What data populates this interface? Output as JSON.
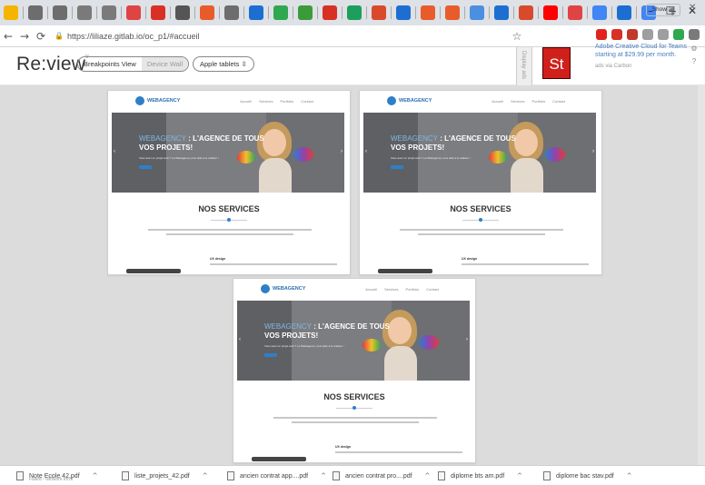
{
  "browser": {
    "url": "https://liliaze.gitlab.io/oc_p1/#accueil",
    "tabs": [
      {
        "icon": "bookmark-icon",
        "color": "#f5b400"
      },
      {
        "icon": "at-icon",
        "color": "#6d6d6d"
      },
      {
        "icon": "at-icon",
        "color": "#6d6d6d"
      },
      {
        "icon": "page-icon",
        "color": "#7a7a7a"
      },
      {
        "icon": "page-icon",
        "color": "#7a7a7a"
      },
      {
        "icon": "heart-icon",
        "color": "#e04343"
      },
      {
        "icon": "mail-icon",
        "color": "#d93025"
      },
      {
        "icon": "send-icon",
        "color": "#555555"
      },
      {
        "icon": "ring-icon",
        "color": "#e85c2c"
      },
      {
        "icon": "at-icon",
        "color": "#6d6d6d"
      },
      {
        "icon": "grid-icon",
        "color": "#1c6fd1"
      },
      {
        "icon": "drive-icon",
        "color": "#2fa84f"
      },
      {
        "icon": "hat-icon",
        "color": "#3b9b3b"
      },
      {
        "icon": "mail-icon",
        "color": "#d93025"
      },
      {
        "icon": "sheet-icon",
        "color": "#1e9e5c"
      },
      {
        "icon": "pen-icon",
        "color": "#d84a2b"
      },
      {
        "icon": "globe-icon",
        "color": "#1c6fd1"
      },
      {
        "icon": "ring-icon",
        "color": "#e85c2c"
      },
      {
        "icon": "ring-icon",
        "color": "#e85c2c"
      },
      {
        "icon": "new-icon",
        "color": "#4b8fe0"
      },
      {
        "icon": "screen-icon",
        "color": "#1c6fd1"
      },
      {
        "icon": "chip-icon",
        "color": "#d84a2b"
      },
      {
        "icon": "youtube-icon",
        "color": "#ff0000"
      },
      {
        "icon": "v-icon",
        "color": "#e04343"
      },
      {
        "icon": "g-icon",
        "color": "#4285f4"
      },
      {
        "icon": "box-icon",
        "color": "#1c6fd1"
      },
      {
        "icon": "g-icon",
        "color": "#4285f4"
      }
    ],
    "new_tab": "+",
    "minimize": "–",
    "maximize": "☐",
    "close": "✕",
    "extensions": [
      {
        "icon": "opera-icon",
        "color": "#e0241d"
      },
      {
        "icon": "chip-icon",
        "color": "#d93025"
      },
      {
        "icon": "stop-icon",
        "color": "#c0392b"
      },
      {
        "icon": "ghost-icon",
        "color": "#9e9e9e"
      },
      {
        "icon": "pin-icon",
        "color": "#9e9e9e"
      },
      {
        "icon": "ext-icon",
        "color": "#2fa84f"
      },
      {
        "icon": "profile-icon",
        "color": "#7a7a7a"
      }
    ]
  },
  "app": {
    "logo": "Re:view",
    "logo_sup": "v",
    "mode_breakpoints": "Breakpoints View",
    "mode_device_wall": "Device Wall",
    "device_select": "Apple tablets ⇳",
    "sidebar_label": "Display ads"
  },
  "ad": {
    "text": "Adobe Creative Cloud for Teams starting at $29.99 per month.",
    "via": "ads via Carbon",
    "logo": "St"
  },
  "site": {
    "brand": "WEBAGENCY",
    "menu": [
      "Accueil",
      "Services",
      "Portfolio",
      "Contact"
    ],
    "hero_highlight": "WEBAGENCY",
    "hero_title_rest": " : L'AGENCE DE TOUS",
    "hero_title_line2": "VOS PROJETS!",
    "hero_sub": "Vous avez un projet web ? La Webagency vous aide à le réaliser !",
    "services_title": "NOS SERVICES",
    "card_title": "UX design"
  },
  "downloads": [
    {
      "name": "Note Ecole 42.pdf",
      "sub": "Failed - Network error"
    },
    {
      "name": "liste_projets_42.pdf",
      "sub": ""
    },
    {
      "name": "ancien contrat app....pdf",
      "sub": ""
    },
    {
      "name": "ancien contrat pro....pdf",
      "sub": ""
    },
    {
      "name": "diplome bts am.pdf",
      "sub": ""
    },
    {
      "name": "diplome bac stav.pdf",
      "sub": ""
    }
  ],
  "show_all": "Show all",
  "close_bar": "✕"
}
